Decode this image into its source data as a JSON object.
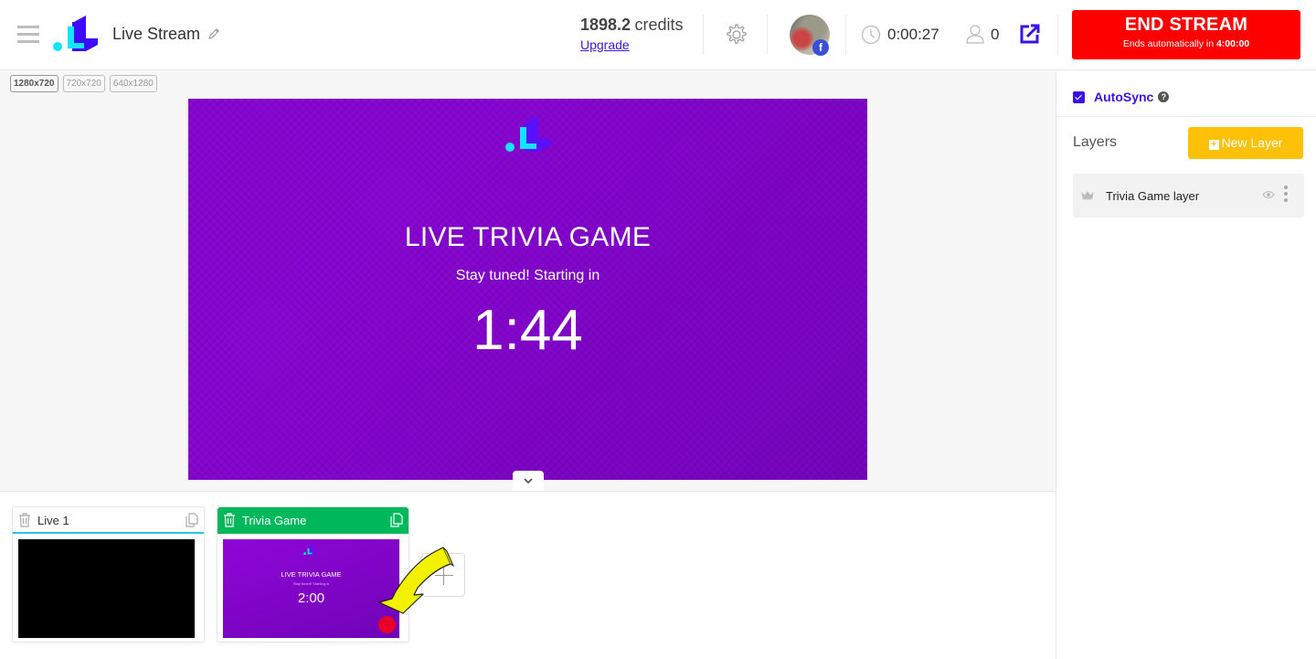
{
  "header": {
    "menu_icon": "hamburger-menu-icon",
    "logo": "brand-logo",
    "title": "Live Stream",
    "edit_icon": "pencil-icon",
    "credits_value": "1898.2",
    "credits_label": "credits",
    "upgrade_label": "Upgrade",
    "settings_icon": "gear-icon",
    "account_badge": "f",
    "elapsed_time": "0:00:27",
    "viewer_count": "0",
    "popout_icon": "external-link-icon",
    "end_stream": {
      "label": "END STREAM",
      "sub_prefix": "Ends automatically in ",
      "sub_time": "4:00:00"
    }
  },
  "stage": {
    "resolutions": [
      "1280x720",
      "720x720",
      "640x1280"
    ],
    "active_resolution": "1280x720",
    "canvas": {
      "title": "LIVE TRIVIA GAME",
      "subtitle": "Stay tuned! Starting in",
      "countdown": "1:44"
    }
  },
  "scenes": [
    {
      "name": "Live 1",
      "thumbnail": "black"
    },
    {
      "name": "Trivia Game",
      "live": true,
      "thumb_title": "LIVE TRIVIA GAME",
      "thumb_sub": "Stay tuned! Starting in",
      "thumb_count": "2:00"
    }
  ],
  "panel": {
    "autosync_label": "AutoSync",
    "autosync_checked": true,
    "help_glyph": "?",
    "layers_title": "Layers",
    "new_layer_label": "New Layer",
    "layers": [
      {
        "name": "Trivia Game layer"
      }
    ]
  },
  "colors": {
    "accent": "#3a12e6",
    "end_stream": "#ff0000",
    "live_scene": "#00b85c",
    "new_layer": "#ffc107",
    "canvas_bg": "#8a06d4"
  }
}
